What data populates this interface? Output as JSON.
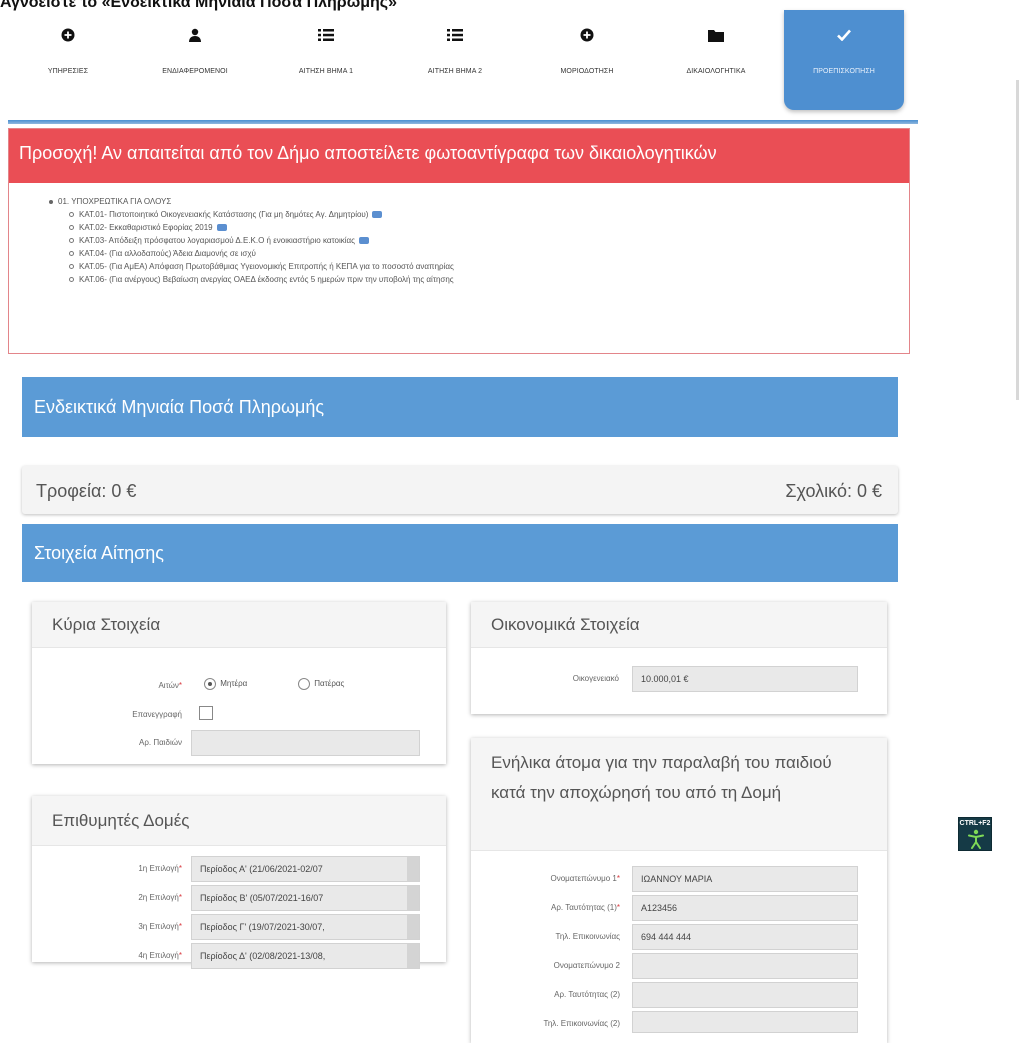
{
  "page": {
    "heading": "Αγνοείστε το «Ενδεικτικά Μηνιαία Ποσά Πληρωμής»"
  },
  "wizard": {
    "steps": [
      {
        "label": "ΥΠΗΡΕΣΙΕΣ",
        "icon": "plus-circle-icon"
      },
      {
        "label": "ΕΝΔΙΑΦΕΡΟΜΕΝΟΙ",
        "icon": "user-icon"
      },
      {
        "label": "ΑΙΤΗΣΗ ΒΗΜΑ 1",
        "icon": "list-icon"
      },
      {
        "label": "ΑΙΤΗΣΗ ΒΗΜΑ 2",
        "icon": "list-icon"
      },
      {
        "label": "ΜΟΡΙΟΔΟΤΗΣΗ",
        "icon": "plus-circle-icon"
      },
      {
        "label": "ΔΙΚΑΙΟΛΟΓΗΤΙΚΑ",
        "icon": "folder-icon"
      },
      {
        "label": "ΠΡΟΕΠΙΣΚΟΠΗΣΗ",
        "icon": "check-icon"
      }
    ]
  },
  "alert": {
    "title": "Προσοχή! Αν απαιτείται από τον Δήμο αποστείλετε φωτοαντίγραφα των δικαιολογητικών",
    "category": "01. ΥΠΟΧΡΕΩΤΙΚΑ ΓΙΑ ΟΛΟΥΣ",
    "items": [
      "ΚΑΤ.01- Πιστοποιητικό Οικογενειακής Κατάστασης (Για μη δημότες Αγ. Δημητρίου)",
      "ΚΑΤ.02- Εκκαθαριστικό Εφορίας 2019",
      "ΚΑΤ.03- Απόδειξη πρόσφατου λογαριασμού Δ.Ε.Κ.Ο ή ενοικιαστήριο κατοικίας",
      "ΚΑΤ.04- (Για αλλοδαπούς) Άδεια Διαμονής σε ισχύ",
      "ΚΑΤ.05- (Για ΑμΕΑ) Απόφαση Πρωτοβάθμιας Υγειονομικής Επιτροπής ή ΚΕΠΑ για το ποσοστό αναπηρίας",
      "ΚΑΤ.06- (Για ανέργους) Βεβαίωση ανεργίας ΟΑΕΔ έκδοσης εντός 5 ημερών πριν την υποβολή της αίτησης"
    ]
  },
  "payments": {
    "title": "Ενδεικτικά Μηνιαία Ποσά Πληρωμής",
    "left": "Τροφεία: 0 €",
    "right": "Σχολικό: 0 €"
  },
  "application": {
    "title": "Στοιχεία Αίτησης"
  },
  "main_info": {
    "title": "Κύρια Στοιχεία",
    "applicant_label": "Αιτών",
    "radio_mother": "Μητέρα",
    "radio_father": "Πατέρας",
    "reregister_label": "Επανεγγραφή",
    "children_label": "Αρ. Παιδιών",
    "children_value": ""
  },
  "financial": {
    "title": "Οικονομικά Στοιχεία",
    "family_label": "Οικογενειακό",
    "family_value": "10.000,01 €"
  },
  "structures": {
    "title": "Επιθυμητές Δομές",
    "choices": [
      {
        "label": "1η Επιλογή",
        "value": "Περίοδος Α' (21/06/2021-02/07"
      },
      {
        "label": "2η Επιλογή",
        "value": "Περίοδος Β' (05/07/2021-16/07"
      },
      {
        "label": "3η Επιλογή",
        "value": "Περίοδος Γ' (19/07/2021-30/07,"
      },
      {
        "label": "4η Επιλογή",
        "value": "Περίοδος Δ' (02/08/2021-13/08,"
      }
    ]
  },
  "adults": {
    "title": "Ενήλικα άτομα για την παραλαβή του παιδιού κατά την αποχώρησή του από τη Δομή",
    "fields": [
      {
        "label": "Ονοματεπώνυμο 1",
        "value": "ΙΩΑΝΝΟΥ ΜΑΡΙΑ",
        "required": "*"
      },
      {
        "label": "Αρ. Ταυτότητας (1)",
        "value": "Α123456",
        "required": "*"
      },
      {
        "label": "Τηλ. Επικοινωνίας",
        "value": "694 444 444",
        "required": ""
      },
      {
        "label": "Ονοματεπώνυμο 2",
        "value": "",
        "required": ""
      },
      {
        "label": "Αρ. Ταυτότητας (2)",
        "value": "",
        "required": ""
      },
      {
        "label": "Τηλ. Επικοινωνίας (2)",
        "value": "",
        "required": ""
      }
    ]
  },
  "accessibility": {
    "button_label": "CTRL+F2",
    "icon": "accessibility-person-icon"
  },
  "colors": {
    "alert_red": "#ea4e55",
    "panel_blue": "#5b9bd6",
    "active_step_blue": "#4e8fd0",
    "accessibility_bg": "#153a46",
    "accessibility_figure": "#7ed957"
  }
}
